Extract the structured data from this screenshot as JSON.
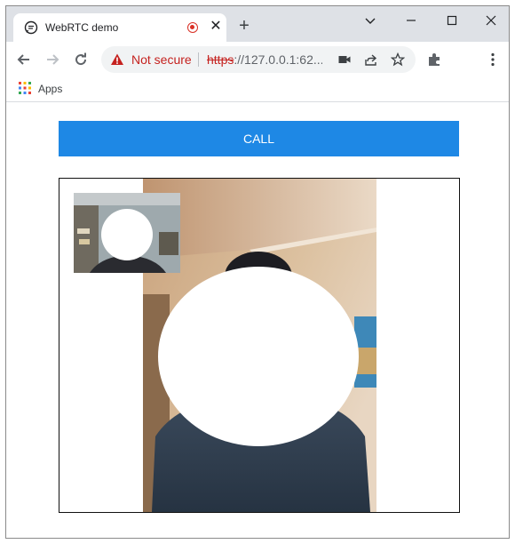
{
  "browser": {
    "tab": {
      "title": "WebRTC demo",
      "close_symbol": "✕",
      "recording_indicator": "recording-icon"
    },
    "new_tab_symbol": "+",
    "address_bar": {
      "security_label": "Not secure",
      "url_scheme": "https",
      "url_rest": "://127.0.0.1:62..."
    },
    "bookmarks": [
      {
        "label": "Apps",
        "icon": "apps-grid-icon"
      }
    ]
  },
  "page": {
    "call_button_label": "CALL",
    "remote_video": {
      "icon": "remote-video-stream"
    },
    "local_video": {
      "icon": "local-video-stream"
    }
  },
  "colors": {
    "call_button": "#1e88e5",
    "not_secure": "#c5221f",
    "tabstrip": "#dee1e6",
    "omnibox": "#f1f3f4"
  }
}
